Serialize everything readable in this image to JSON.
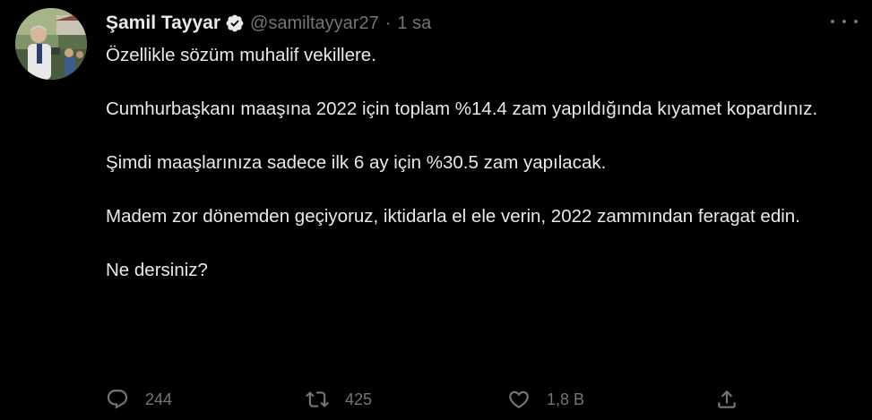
{
  "tweet": {
    "author_name": "Şamil Tayyar",
    "handle": "@samiltayyar27",
    "separator": "·",
    "time": "1 sa",
    "paragraphs": [
      "Özellikle sözüm muhalif vekillere.",
      "Cumhurbaşkanı maaşına 2022 için toplam %14.4 zam yapıldığında kıyamet kopardınız.",
      "Şimdi maaşlarınıza sadece ilk 6 ay için %30.5 zam yapılacak.",
      "Madem zor dönemden geçiyoruz, iktidarla el ele verin, 2022 zammından feragat edin.",
      "Ne dersiniz?"
    ],
    "counts": {
      "replies": "244",
      "retweets": "425",
      "likes": "1,8 B"
    }
  },
  "icons": {
    "verified": "verified-badge-icon",
    "more": "more-options-icon",
    "reply": "reply-icon",
    "retweet": "retweet-icon",
    "like": "heart-icon",
    "share": "share-icon"
  },
  "colors": {
    "background": "#000000",
    "primary_text": "#e7e9ea",
    "secondary_text": "#71767b"
  }
}
